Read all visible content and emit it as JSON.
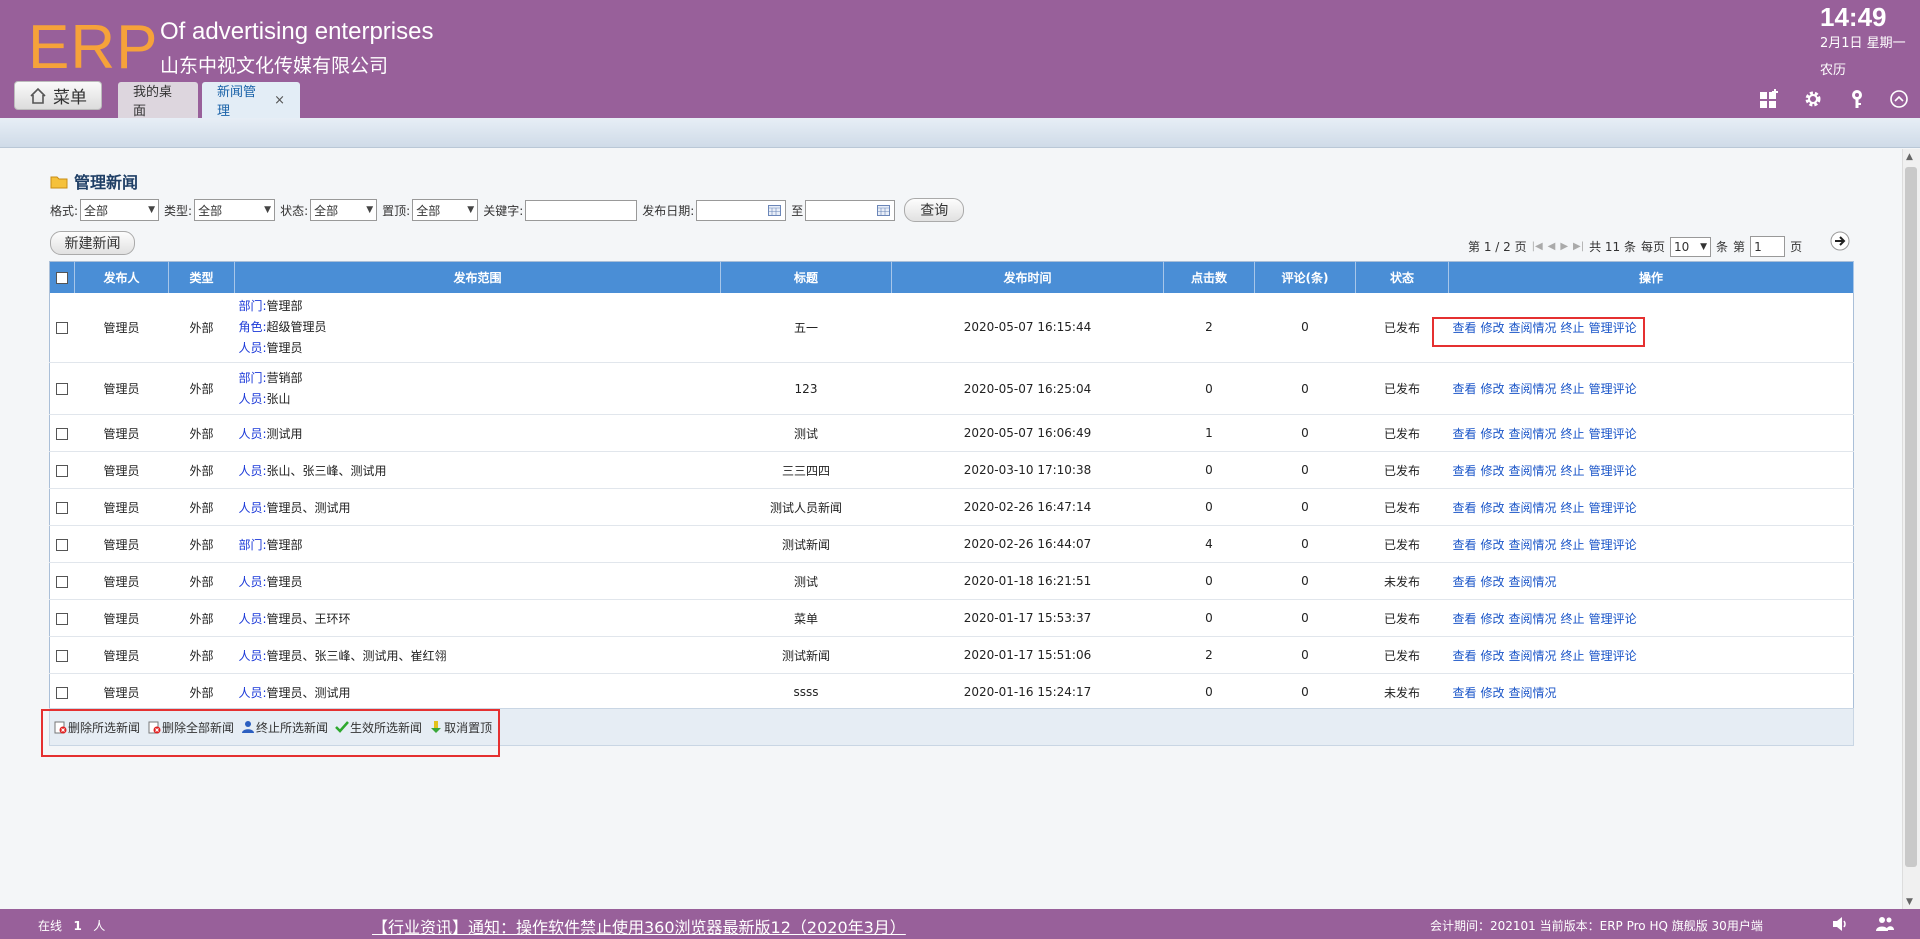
{
  "header": {
    "logo": "ERP",
    "company_en": "Of advertising enterprises",
    "company_cn": "山东中视文化传媒有限公司",
    "clock": "14:49",
    "date": "2月1日 星期一",
    "lunar": "农历",
    "menu_label": "菜单",
    "tabs": [
      {
        "label": "我的桌面"
      },
      {
        "label": "新闻管理",
        "close": "×"
      }
    ]
  },
  "page": {
    "title": "管理新闻",
    "new_button": "新建新闻"
  },
  "filters": {
    "format_label": "格式:",
    "format_value": "全部",
    "type_label": "类型:",
    "type_value": "全部",
    "status_label": "状态:",
    "status_value": "全部",
    "top_label": "置顶:",
    "top_value": "全部",
    "keyword_label": "关键字:",
    "date_label": "发布日期:",
    "to_label": "至",
    "query_button": "查询"
  },
  "pager": {
    "page_info": "第 1 / 2 页",
    "total": "共 11 条",
    "per_page_label": "每页",
    "per_page_value": "10",
    "unit": "条",
    "jump_label": "第",
    "jump_value": "1",
    "page_unit": "页"
  },
  "table": {
    "columns": [
      "发布人",
      "类型",
      "发布范围",
      "标题",
      "发布时间",
      "点击数",
      "评论(条)",
      "状态",
      "操作"
    ],
    "scope_keys": {
      "dept": "部门:",
      "role": "角色:",
      "person": "人员:"
    },
    "ops": {
      "view": "查看",
      "edit": "修改",
      "read": "查阅情况",
      "stop": "终止",
      "comment": "管理评论"
    },
    "rows": [
      {
        "publisher": "管理员",
        "type": "外部",
        "dept": "管理部",
        "role": "超级管理员",
        "person": "管理员",
        "title": "五一",
        "time": "2020-05-07 16:15:44",
        "clicks": "2",
        "comments": "0",
        "status": "已发布"
      },
      {
        "publisher": "管理员",
        "type": "外部",
        "dept": "营销部",
        "person": "张山",
        "title": "123",
        "time": "2020-05-07 16:25:04",
        "clicks": "0",
        "comments": "0",
        "status": "已发布"
      },
      {
        "publisher": "管理员",
        "type": "外部",
        "person": "测试用",
        "title": "测试",
        "time": "2020-05-07 16:06:49",
        "clicks": "1",
        "comments": "0",
        "status": "已发布"
      },
      {
        "publisher": "管理员",
        "type": "外部",
        "person": "张山、张三峰、测试用",
        "title": "三三四四",
        "time": "2020-03-10 17:10:38",
        "clicks": "0",
        "comments": "0",
        "status": "已发布"
      },
      {
        "publisher": "管理员",
        "type": "外部",
        "person": "管理员、测试用",
        "title": "测试人员新闻",
        "time": "2020-02-26 16:47:14",
        "clicks": "0",
        "comments": "0",
        "status": "已发布"
      },
      {
        "publisher": "管理员",
        "type": "外部",
        "dept": "管理部",
        "title": "测试新闻",
        "time": "2020-02-26 16:44:07",
        "clicks": "4",
        "comments": "0",
        "status": "已发布"
      },
      {
        "publisher": "管理员",
        "type": "外部",
        "person": "管理员",
        "title": "测试",
        "time": "2020-01-18 16:21:51",
        "clicks": "0",
        "comments": "0",
        "status": "未发布"
      },
      {
        "publisher": "管理员",
        "type": "外部",
        "person": "管理员、王环环",
        "title": "菜单",
        "time": "2020-01-17 15:53:37",
        "clicks": "0",
        "comments": "0",
        "status": "已发布"
      },
      {
        "publisher": "管理员",
        "type": "外部",
        "person": "管理员、张三峰、测试用、崔红翎",
        "title": "测试新闻",
        "time": "2020-01-17 15:51:06",
        "clicks": "2",
        "comments": "0",
        "status": "已发布"
      },
      {
        "publisher": "管理员",
        "type": "外部",
        "person": "管理员、测试用",
        "title": "ssss",
        "time": "2020-01-16 15:24:17",
        "clicks": "0",
        "comments": "0",
        "status": "未发布"
      }
    ]
  },
  "batch": {
    "delete_selected": "删除所选新闻",
    "delete_all": "删除全部新闻",
    "stop_selected": "终止所选新闻",
    "activate_selected": "生效所选新闻",
    "cancel_top": "取消置顶"
  },
  "footer": {
    "online_label": "在线",
    "online_count": "1",
    "online_unit": "人",
    "news": "【行业资讯】通知：操作软件禁止使用360浏览器最新版12（2020年3月）",
    "version": "会计期间：202101 当前版本：ERP Pro HQ 旗舰版 30用户端"
  },
  "colors": {
    "header_bg": "#98609a",
    "logo": "#f6a23a",
    "table_header": "#4a8ed6",
    "published": "#1a9a1a",
    "unpublished": "#e01b1b",
    "link": "#1a55c8",
    "highlight_box": "#e53030"
  }
}
